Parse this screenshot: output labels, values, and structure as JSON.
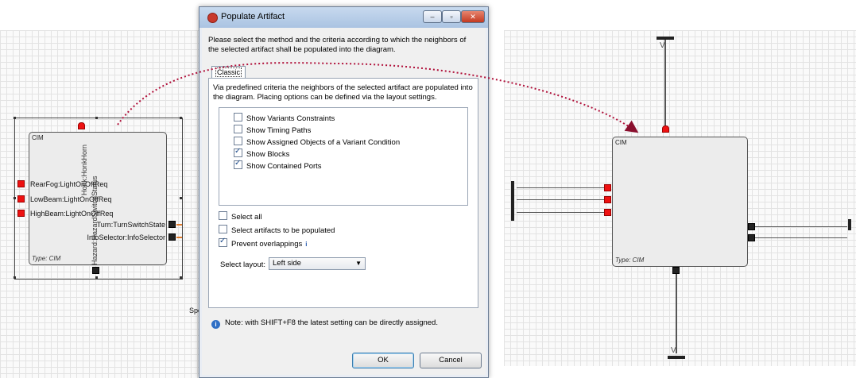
{
  "dialog": {
    "title": "Populate Artifact",
    "instructions": "Please select the method and the criteria according to which the neighbors of the selected artifact shall be populated into the diagram.",
    "tab_label": "Classic",
    "panel_description": "Via predefined criteria the neighbors of the selected artifact are populated into the diagram. Placing options can be defined via the layout settings.",
    "criteria": [
      {
        "label": "Show Variants Constraints",
        "checked": false
      },
      {
        "label": "Show Timing Paths",
        "checked": false
      },
      {
        "label": "Show Assigned Objects of a Variant Condition",
        "checked": false
      },
      {
        "label": "Show Blocks",
        "checked": true
      },
      {
        "label": "Show Contained Ports",
        "checked": true
      }
    ],
    "options": [
      {
        "label": "Select all",
        "checked": false
      },
      {
        "label": "Select artifacts to be populated",
        "checked": false
      },
      {
        "label": "Prevent overlappings",
        "checked": true
      }
    ],
    "layout_label": "Select layout:",
    "layout_value": "Left side",
    "note": "Note: with SHIFT+F8 the latest setting can be directly assigned.",
    "ok_label": "OK",
    "cancel_label": "Cancel"
  },
  "left_diagram": {
    "block_name": "CIM",
    "block_type": "Type: CIM",
    "left_ports": [
      "RearFog:LightOnOffReq",
      "LowBeam:LightOnOffReq",
      "HighBeam:LightOnOffReq"
    ],
    "right_ports": [
      "Turn:TurnSwitchState",
      "InfoSelector:InfoSelector"
    ],
    "top_port": "Honk:HonkHorn",
    "bottom_port": "Hazard:HazardSwitchStatus",
    "partial_text": "Spe"
  },
  "right_diagram": {
    "block_name": "CIM",
    "block_type": "Type: CIM"
  },
  "colors": {
    "port_red": "#ee1111",
    "connector_dots": "#b0103a",
    "dialog_title_bar": "#b5cbe6"
  }
}
